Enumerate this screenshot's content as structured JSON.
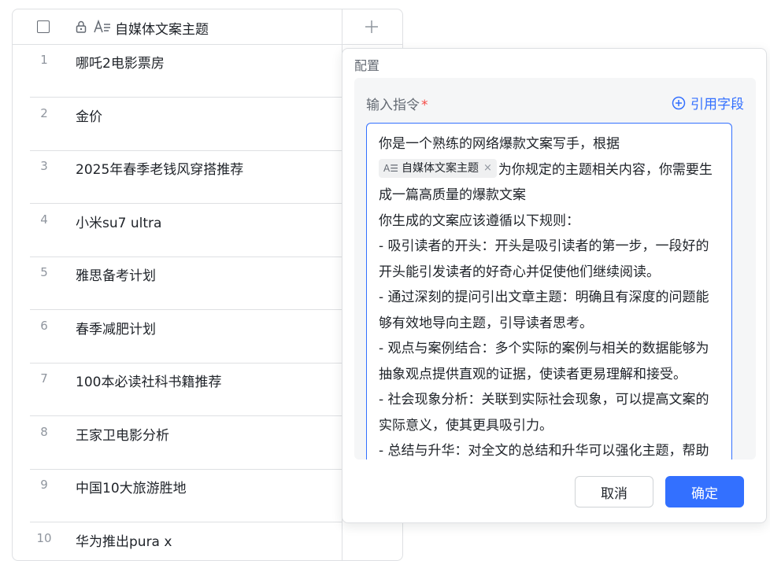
{
  "table": {
    "header": {
      "column_title": "自媒体文案主题",
      "type_icon": "text-field-icon",
      "lock_icon": "lock-icon",
      "add_icon": "plus-icon"
    },
    "rows": [
      {
        "num": "1",
        "text": "哪吒2电影票房"
      },
      {
        "num": "2",
        "text": "金价"
      },
      {
        "num": "3",
        "text": "2025年春季老钱风穿搭推荐"
      },
      {
        "num": "4",
        "text": "小米su7 ultra"
      },
      {
        "num": "5",
        "text": "雅思备考计划"
      },
      {
        "num": "6",
        "text": "春季减肥计划"
      },
      {
        "num": "7",
        "text": "100本必读社科书籍推荐"
      },
      {
        "num": "8",
        "text": "王家卫电影分析"
      },
      {
        "num": "9",
        "text": "中国10大旅游胜地"
      },
      {
        "num": "10",
        "text": "华为推出pura x"
      }
    ]
  },
  "panel": {
    "title": "配置",
    "field_label": "输入指令",
    "required_mark": "*",
    "ref_button": "引用字段",
    "editor": {
      "line1": "你是一个熟练的网络爆款文案写手，根据",
      "chip_label": "自媒体文案主题",
      "chip_close": "×",
      "after_chip": "为你规定的主题相关内容，你需要生成一篇高质量的爆款文案",
      "p2": "你生成的文案应该遵循以下规则：",
      "p3": "- 吸引读者的开头：开头是吸引读者的第一步，一段好的开头能引发读者的好奇心并促使他们继续阅读。",
      "p4": "- 通过深刻的提问引出文章主题：明确且有深度的问题能够有效地导向主题，引导读者思考。",
      "p5": "- 观点与案例结合：多个实际的案例与相关的数据能够为抽象观点提供直观的证据，使读者更易理解和接受。",
      "p6": "- 社会现象分析：关联到实际社会现象，可以提高文案的实际意义，使其更具吸引力。",
      "p7": "- 总结与升华：对全文的总结和升华可以强化主题，帮助"
    },
    "cancel": "取消",
    "confirm": "确定"
  },
  "colors": {
    "accent": "#3370ff",
    "required": "#f54a45",
    "border": "#dee0e3"
  }
}
